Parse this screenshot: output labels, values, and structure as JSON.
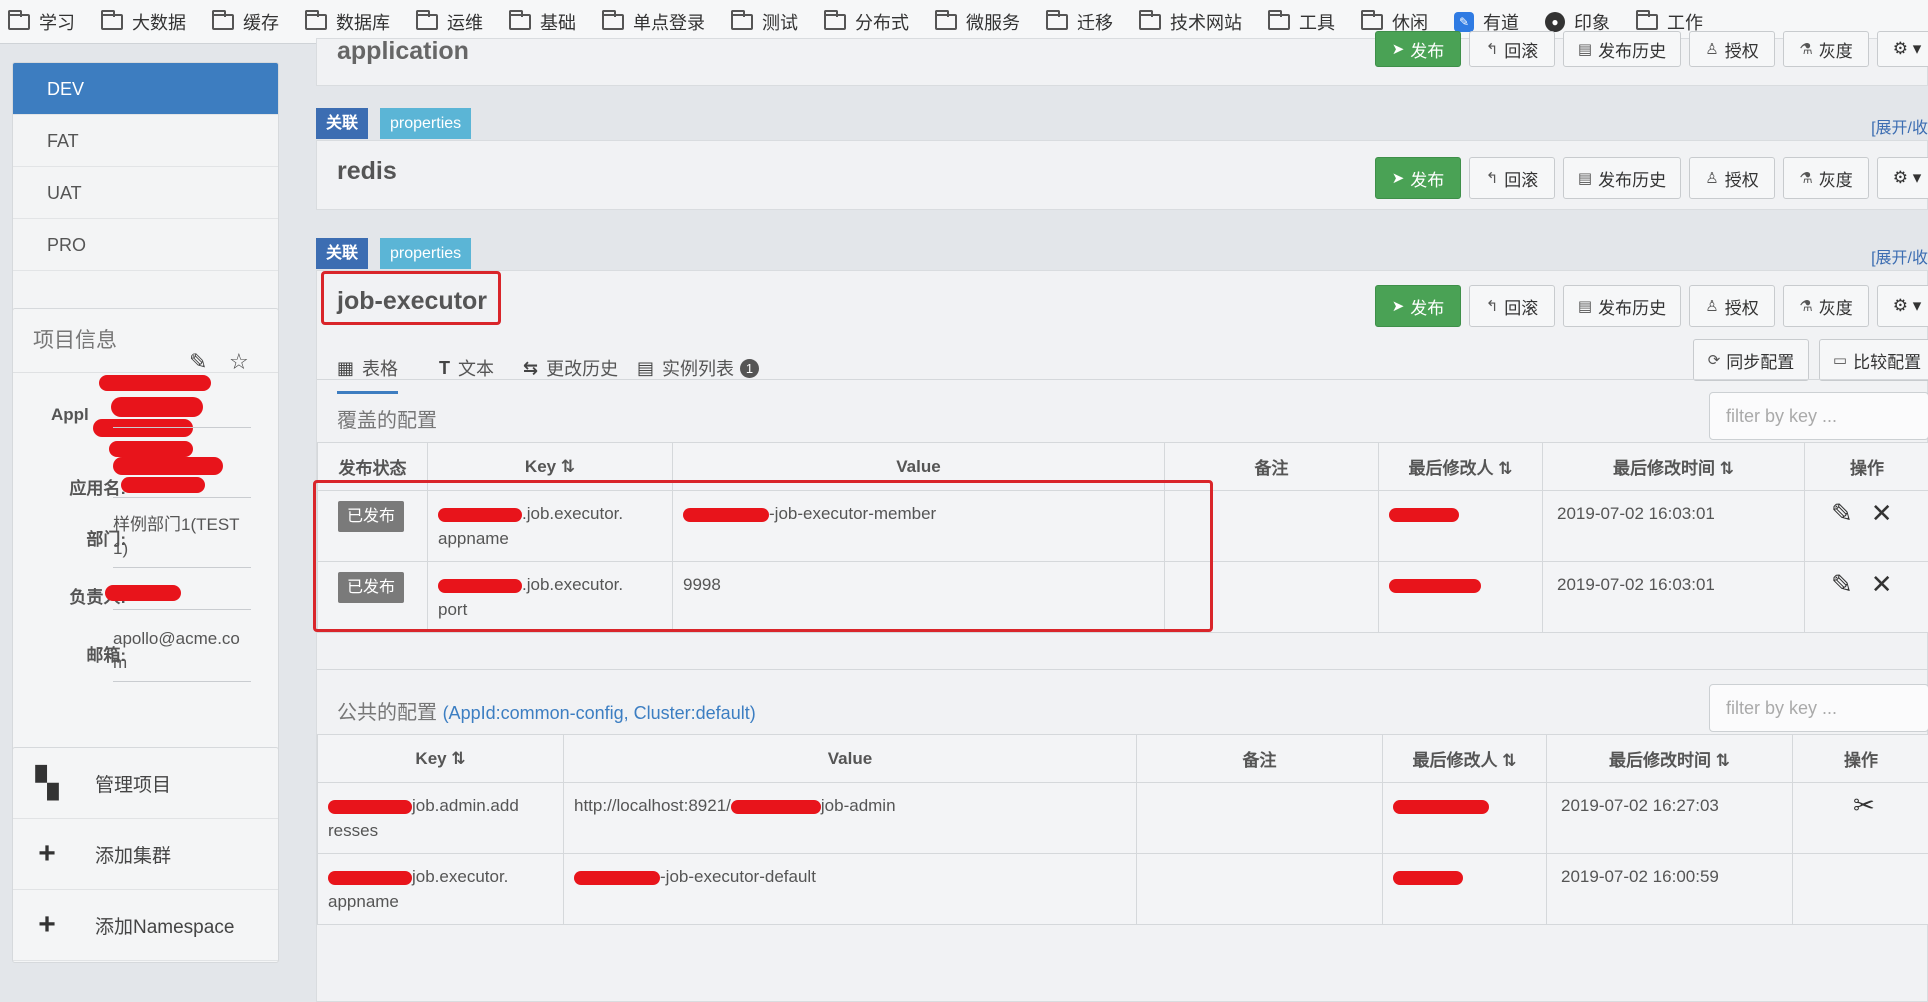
{
  "bookmarks": [
    {
      "label": "学习",
      "icon": "folder-icon"
    },
    {
      "label": "大数据",
      "icon": "folder-icon"
    },
    {
      "label": "缓存",
      "icon": "folder-icon"
    },
    {
      "label": "数据库",
      "icon": "folder-icon"
    },
    {
      "label": "运维",
      "icon": "folder-icon"
    },
    {
      "label": "基础",
      "icon": "folder-icon"
    },
    {
      "label": "单点登录",
      "icon": "folder-icon"
    },
    {
      "label": "测试",
      "icon": "folder-icon"
    },
    {
      "label": "分布式",
      "icon": "folder-icon"
    },
    {
      "label": "微服务",
      "icon": "folder-icon"
    },
    {
      "label": "迁移",
      "icon": "folder-icon"
    },
    {
      "label": "技术网站",
      "icon": "folder-icon"
    },
    {
      "label": "工具",
      "icon": "folder-icon"
    },
    {
      "label": "休闲",
      "icon": "folder-icon"
    },
    {
      "label": "有道",
      "icon": "youdao-icon"
    },
    {
      "label": "印象",
      "icon": "evernote-icon"
    },
    {
      "label": "工作",
      "icon": "folder-icon"
    }
  ],
  "envs": [
    {
      "label": "DEV",
      "active": true
    },
    {
      "label": "FAT",
      "active": false
    },
    {
      "label": "UAT",
      "active": false
    },
    {
      "label": "PRO",
      "active": false
    }
  ],
  "project_info": {
    "title": "项目信息",
    "appid_label": "Appl",
    "appname_label": "应用名:",
    "dept_label": "部门:",
    "dept_value": "样例部门1(TEST1)",
    "owner_label": "负责人:",
    "email_label": "邮箱:",
    "email_value": "apollo@acme.com"
  },
  "side_actions": [
    {
      "label": "管理项目",
      "icon": "grid-icon"
    },
    {
      "label": "添加集群",
      "icon": "plus-icon"
    },
    {
      "label": "添加Namespace",
      "icon": "plus-icon"
    }
  ],
  "namespace_buttons": {
    "publish": "发布",
    "rollback": "回滚",
    "history": "发布历史",
    "grant": "授权",
    "gray": "灰度"
  },
  "namespaces": {
    "application": {
      "title": "application"
    },
    "redis": {
      "title": "redis",
      "tag_link": "关联",
      "tag_format": "properties",
      "expand": "[展开/收"
    },
    "job_executor": {
      "title": "job-executor",
      "tag_link": "关联",
      "tag_format": "properties",
      "expand": "[展开/收"
    }
  },
  "tabs": [
    {
      "label": "表格",
      "icon": "table-icon",
      "active": true
    },
    {
      "label": "文本",
      "icon": "text-icon",
      "active": false
    },
    {
      "label": "更改历史",
      "icon": "history-icon",
      "active": false
    },
    {
      "label": "实例列表",
      "icon": "instance-icon",
      "active": false,
      "badge": "1"
    }
  ],
  "toolbar": {
    "sync": "同步配置",
    "compare": "比较配置"
  },
  "override_section": {
    "title": "覆盖的配置",
    "filter_placeholder": "filter by key ...",
    "headers": [
      "发布状态",
      "Key",
      "Value",
      "备注",
      "最后修改人",
      "最后修改时间",
      "操作"
    ],
    "rows": [
      {
        "status": "已发布",
        "key_suffix": ".job.executor.",
        "key_tail": "appname",
        "value_suffix": "-job-executor-member",
        "comment": "",
        "time": "2019-07-02 16:03:01"
      },
      {
        "status": "已发布",
        "key_suffix": ".job.executor.",
        "key_tail": "port",
        "value_suffix": "9998",
        "comment": "",
        "time": "2019-07-02 16:03:01"
      }
    ]
  },
  "public_section": {
    "title": "公共的配置",
    "subtitle": "(AppId:common-config, Cluster:default)",
    "filter_placeholder": "filter by key ...",
    "headers": [
      "Key",
      "Value",
      "备注",
      "最后修改人",
      "最后修改时间",
      "操作"
    ],
    "rows": [
      {
        "key_suffix": "job.admin.add",
        "key_tail": "resses",
        "value_prefix": "http://localhost:8921/",
        "value_suffix": "job-admin",
        "time": "2019-07-02 16:27:03"
      },
      {
        "key_suffix": "job.executor.",
        "key_tail": "appname",
        "value_prefix": "",
        "value_suffix": "-job-executor-default",
        "time": "2019-07-02 16:00:59"
      }
    ]
  },
  "colors": {
    "accent": "#3d7dc0",
    "publish_green": "#4aa255",
    "highlight_red": "#d9252a",
    "tag_blue": "#3c6db2",
    "tag_cyan": "#5bb5d6"
  }
}
